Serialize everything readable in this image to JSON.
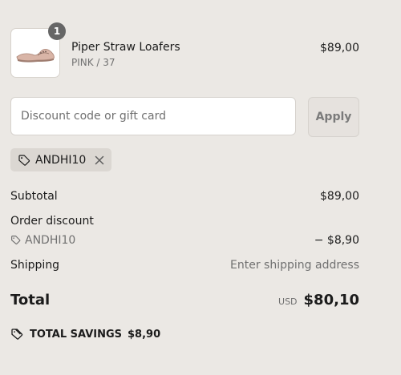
{
  "product": {
    "quantity": "1",
    "title": "Piper Straw Loafers",
    "variant": "PINK / 37",
    "price": "$89,00",
    "image_icon": "shoe-image"
  },
  "discount": {
    "placeholder": "Discount code or gift card",
    "apply_label": "Apply"
  },
  "applied_code": {
    "label": "ANDHI10",
    "tag_icon": "tag-icon",
    "remove_icon": "close-icon"
  },
  "totals": {
    "subtotal_label": "Subtotal",
    "subtotal_value": "$89,00",
    "order_discount_label": "Order discount",
    "order_discount_code": "ANDHI10",
    "order_discount_value": "− $8,90",
    "shipping_label": "Shipping",
    "shipping_value": "Enter shipping address",
    "total_label": "Total",
    "currency": "USD",
    "total_value": "$80,10"
  },
  "savings": {
    "label": "TOTAL SAVINGS",
    "amount": "$8,90"
  },
  "colors": {
    "background": "#ebe8e4",
    "badge": "#666666",
    "applied_chip": "#dbd7d2",
    "muted_text": "#707070"
  }
}
